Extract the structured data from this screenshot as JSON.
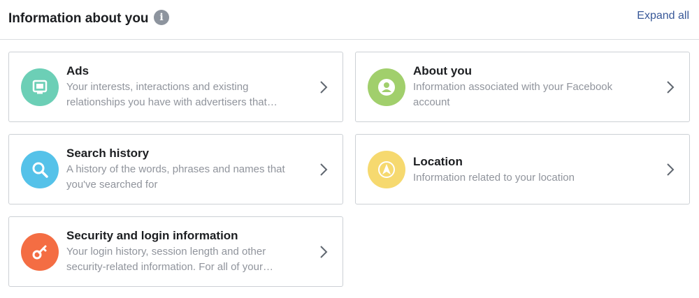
{
  "header": {
    "title": "Information about you",
    "info_icon": "info-icon",
    "expand_label": "Expand all"
  },
  "colors": {
    "ads": "#6ccfb6",
    "about": "#a1cf6c",
    "search": "#55c2e9",
    "location": "#f6d96f",
    "security": "#f46d43",
    "link": "#385898"
  },
  "cards": [
    {
      "title": "Ads",
      "desc_line1": "Your interests, interactions and existing",
      "desc_line2": "relationships you have with advertisers that…",
      "icon": "monitor-icon"
    },
    {
      "title": "About you",
      "desc_line1": "Information associated with your Facebook",
      "desc_line2": "account",
      "icon": "person-icon"
    },
    {
      "title": "Search history",
      "desc_line1": "A history of the words, phrases and names that",
      "desc_line2": "you've searched for",
      "icon": "magnifier-icon"
    },
    {
      "title": "Location",
      "desc_line1": "Information related to your location",
      "icon": "navigation-arrow-icon"
    },
    {
      "title": "Security and login information",
      "desc_line1": "Your login history, session length and other",
      "desc_line2": "security-related information. For all of your…",
      "icon": "key-icon"
    }
  ]
}
